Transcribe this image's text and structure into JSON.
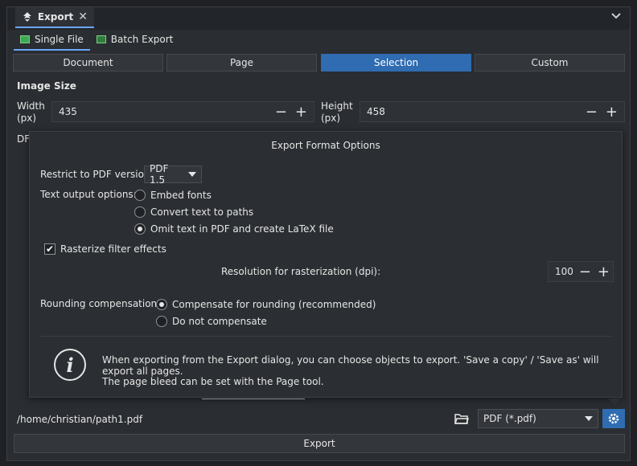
{
  "window": {
    "tab_title": "Export",
    "close_glyph": "✕",
    "chevron_glyph": "⌄"
  },
  "subtabs": [
    {
      "label": "Single File",
      "active": true
    },
    {
      "label": "Batch Export",
      "active": false
    }
  ],
  "segments": [
    {
      "label": "Document",
      "active": false
    },
    {
      "label": "Page",
      "active": false
    },
    {
      "label": "Selection",
      "active": true
    },
    {
      "label": "Custom",
      "active": false
    }
  ],
  "image_size": {
    "heading": "Image Size",
    "width_label": "Width",
    "width_unit": "(px)",
    "width_value": "435",
    "height_label": "Height",
    "height_unit": "(px)",
    "height_value": "458",
    "dpi_partial": "DF"
  },
  "popup": {
    "title": "Export Format Options",
    "pdf_version_label": "Restrict to PDF version:",
    "pdf_version_value": "PDF 1.5",
    "text_output_label": "Text output options:",
    "text_options": [
      {
        "label": "Embed fonts",
        "selected": false
      },
      {
        "label": "Convert text to paths",
        "selected": false
      },
      {
        "label": "Omit text in PDF and create LaTeX file",
        "selected": true
      }
    ],
    "rasterize_label": "Rasterize filter effects",
    "rasterize_checked": true,
    "resolution_label": "Resolution for rasterization (dpi):",
    "resolution_value": "100",
    "rounding_label": "Rounding compensation:",
    "rounding_options": [
      {
        "label": "Compensate for rounding (recommended)",
        "selected": true
      },
      {
        "label": "Do not compensate",
        "selected": false
      }
    ],
    "info_line1": "When exporting from the Export dialog, you can choose objects to export. 'Save a copy' / 'Save as' will export all pages.",
    "info_line2": "The page bleed can be set with the Page tool."
  },
  "bottom": {
    "path": "/home/christian/path1.pdf",
    "format": "PDF (*.pdf)",
    "export_label": "Export"
  },
  "colors": {
    "accent": "#2f6cb1",
    "background": "#2a2d31"
  }
}
